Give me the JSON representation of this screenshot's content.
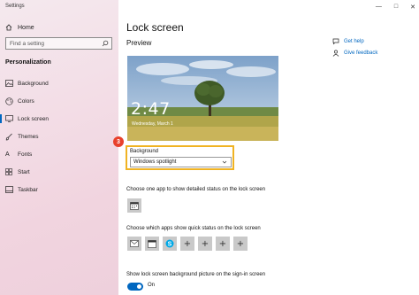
{
  "window": {
    "title": "Settings"
  },
  "sidebar": {
    "home_label": "Home",
    "search_placeholder": "Find a setting",
    "section_title": "Personalization",
    "items": [
      {
        "label": "Background",
        "icon": "picture-icon"
      },
      {
        "label": "Colors",
        "icon": "palette-icon"
      },
      {
        "label": "Lock screen",
        "icon": "lock-screen-icon",
        "active": true
      },
      {
        "label": "Themes",
        "icon": "brush-icon"
      },
      {
        "label": "Fonts",
        "icon": "font-icon"
      },
      {
        "label": "Start",
        "icon": "start-icon"
      },
      {
        "label": "Taskbar",
        "icon": "taskbar-icon"
      }
    ]
  },
  "main": {
    "title": "Lock screen",
    "preview_label": "Preview",
    "preview_time": "2:47",
    "preview_date": "Wednesday, March 1",
    "step_badge": "3",
    "background_label": "Background",
    "background_value": "Windows spotlight",
    "detailed_status_text": "Choose one app to show detailed status on the lock screen",
    "quick_status_text": "Choose which apps show quick status on the lock screen",
    "signin_bg_text": "Show lock screen background picture on the sign-in screen",
    "toggle_state": "On"
  },
  "help": {
    "get_help": "Get help",
    "give_feedback": "Give feedback"
  },
  "colors": {
    "accent": "#0067c0",
    "highlight": "#f0b323",
    "badge": "#e8412c"
  }
}
